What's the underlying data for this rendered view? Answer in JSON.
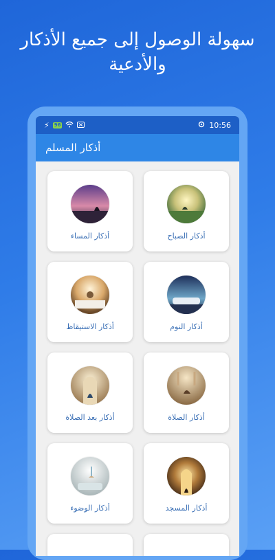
{
  "headline": "سهولة الوصول إلى جميع الأذكار والأدعية",
  "status_bar": {
    "time": "10:56",
    "battery": "96"
  },
  "app_bar": {
    "title": "أذكار المسلم"
  },
  "cards": [
    {
      "label": "أذكار الصباح",
      "icon": "morning-scene"
    },
    {
      "label": "أذكار المساء",
      "icon": "evening-scene"
    },
    {
      "label": "أذكار النوم",
      "icon": "sleep-scene"
    },
    {
      "label": "أذكار الاستيقاظ",
      "icon": "waking-scene"
    },
    {
      "label": "أذكار الصلاة",
      "icon": "prayer-scene"
    },
    {
      "label": "أذكار بعد الصلاة",
      "icon": "after-prayer-scene"
    },
    {
      "label": "أذكار المسجد",
      "icon": "mosque-scene"
    },
    {
      "label": "أذكار الوضوء",
      "icon": "ablution-scene"
    }
  ],
  "colors": {
    "status_bar": "#1d5fc6",
    "app_bar": "#2e86e6",
    "label": "#3a6fb5"
  }
}
